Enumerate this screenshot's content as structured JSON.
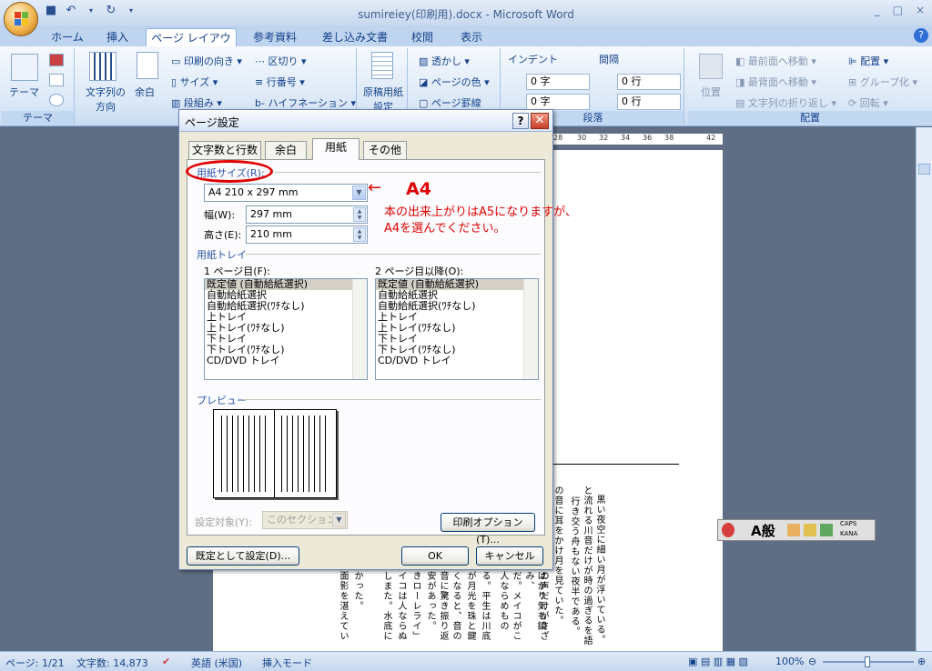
{
  "window": {
    "title": "sumireiey(印刷用).docx - Microsoft Word",
    "controls": [
      "_",
      "□",
      "×"
    ]
  },
  "ribbon_tabs": [
    "ホーム",
    "挿入",
    "ページ レイアウト",
    "参考資料",
    "差し込み文書",
    "校閲",
    "表示"
  ],
  "ribbon": {
    "theme_group": {
      "label": "テーマ",
      "button": "テーマ"
    },
    "page_setup": {
      "text_direction": "文字列の方向",
      "margins": "余白",
      "orientation": "印刷の向き",
      "size": "サイズ",
      "columns": "段組み",
      "breaks": "区切り",
      "line_numbers": "行番号",
      "hyphenation": "ハイフネーション"
    },
    "manuscript": "原稿用紙設定",
    "background": {
      "watermark": "透かし",
      "page_color": "ページの色",
      "page_borders": "ページ罫線"
    },
    "paragraph": {
      "indent_label": "インデント",
      "spacing_label": "間隔",
      "indent_left": "0 字",
      "indent_right": "0 字",
      "spacing_before": "0 行",
      "spacing_after": "0 行",
      "group_label": "段落"
    },
    "arrange": {
      "position": "位置",
      "bring_front": "最前面へ移動",
      "send_back": "最背面へ移動",
      "text_wrap": "文字列の折り返し",
      "align": "配置",
      "group": "グループ化",
      "rotate": "回転",
      "group_label": "配置"
    }
  },
  "ruler_ticks": [
    "28",
    "30",
    "32",
    "34",
    "36",
    "38",
    "42"
  ],
  "dialog": {
    "title": "ページ設定",
    "tabs": [
      "文字数と行数",
      "余白",
      "用紙",
      "その他"
    ],
    "active_tab": "用紙",
    "paper_size_label": "用紙サイズ(R):",
    "paper_size_value": "A4 210 x 297 mm",
    "width_label": "幅(W):",
    "width_value": "297 mm",
    "height_label": "高さ(E):",
    "height_value": "210 mm",
    "paper_tray_label": "用紙トレイ",
    "first_page_label": "1 ページ目(F):",
    "other_pages_label": "2 ページ目以降(O):",
    "tray_items": [
      "既定値 (自動給紙選択)",
      "自動給紙選択",
      "自動給紙選択(ﾜﾁなし)",
      "上トレイ",
      "上トレイ(ﾜﾁなし)",
      "下トレイ",
      "下トレイ(ﾜﾁなし)",
      "CD/DVD トレイ"
    ],
    "preview_label": "プレビュー",
    "apply_to_label": "設定対象(Y):",
    "apply_to_value": "このセクション",
    "print_options": "印刷オプション(T)...",
    "default_button": "既定として設定(D)...",
    "ok": "OK",
    "cancel": "キャンセル"
  },
  "annotation": {
    "arrow": "←",
    "big": "A4",
    "line1": "本の出来上がりはA5になりますが、",
    "line2": "A4を選んでください。"
  },
  "ime_bar": {
    "mode": "A般",
    "caps": "CAPS",
    "kana": "KANA"
  },
  "status_bar": {
    "page": "ページ: 1/21",
    "word_count": "文字数: 14,873",
    "language": "英語 (米国)",
    "mode": "挿入モード",
    "zoom": "100%"
  },
  "document_columns": [
    "黒い夜空に細い月が浮いている。",
    "と流れる川音だけが時の過ぎるを語",
    "行き交う舟もない夜半である。",
    "の音に耳をかけ月を見ていた。",
    "の声だけがさざ",
    "はかり気も鎮み、",
    "だ。メイコがこ",
    "人ならめもの",
    "る。平生は川底",
    "が月光を珠と鍵",
    "くなると、音の",
    "音に驚き振り返",
    "安があった。",
    "きローレライ」",
    "イコは人ならぬ",
    "しまた。水底に",
    "かった。",
    "面影を湛えてい"
  ]
}
